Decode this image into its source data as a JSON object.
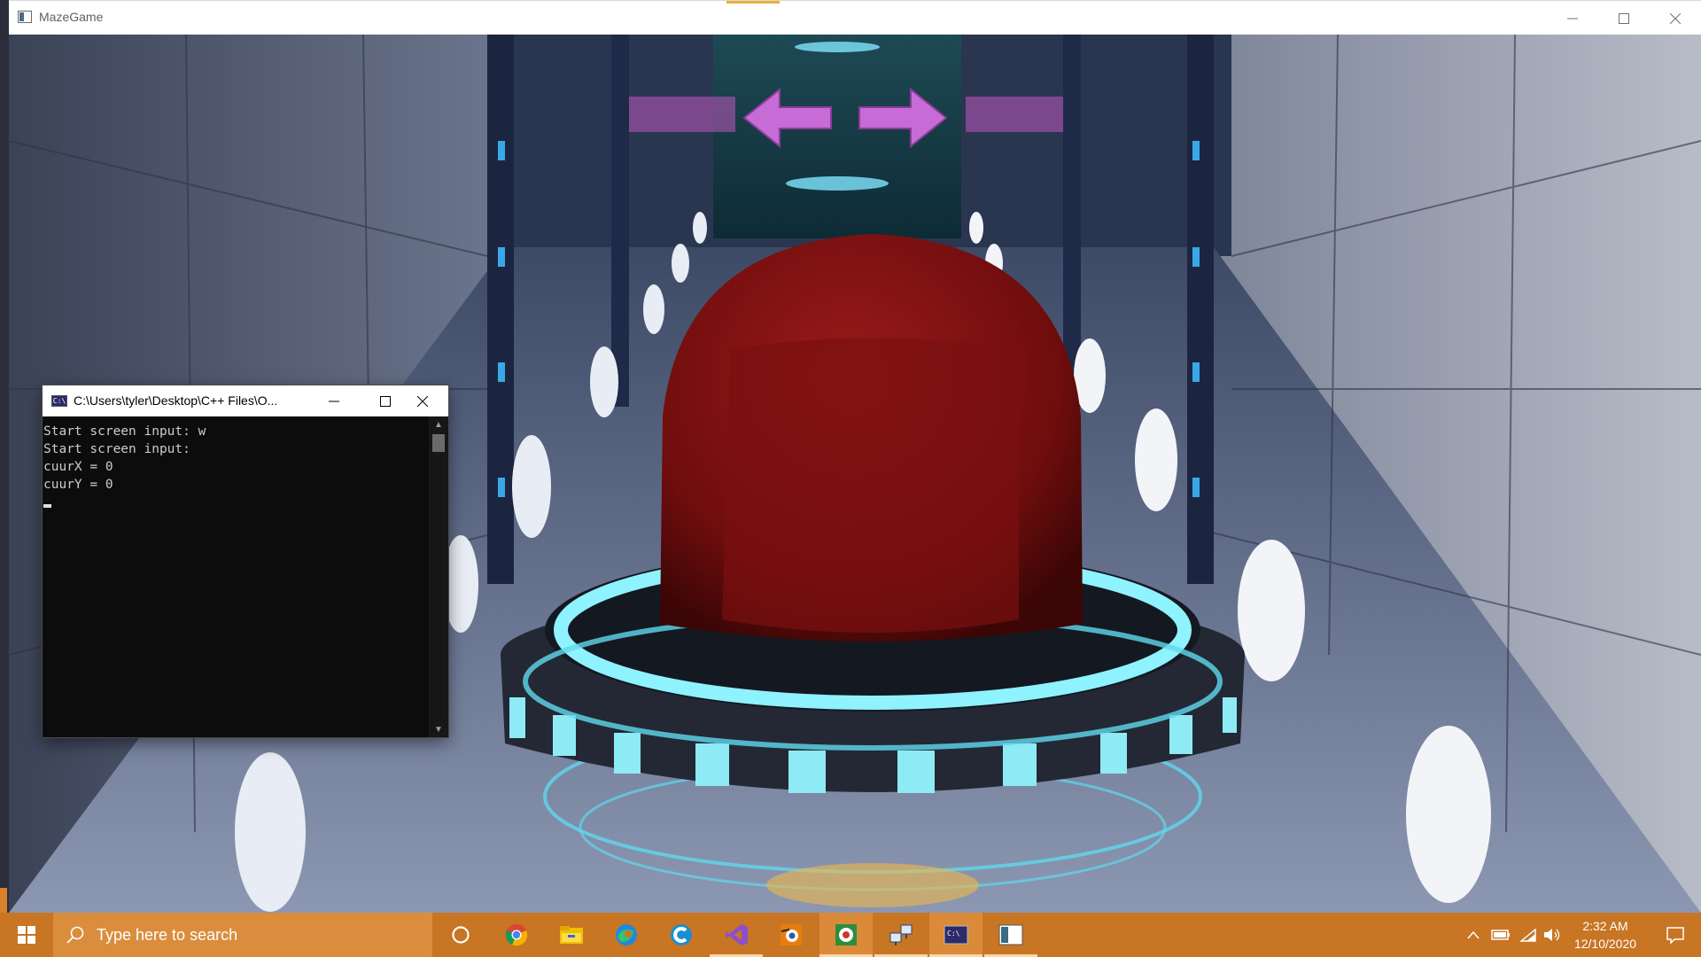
{
  "game_window": {
    "title": "MazeGame",
    "controls": [
      "minimize",
      "maximize",
      "close"
    ]
  },
  "console": {
    "title": "C:\\Users\\tyler\\Desktop\\C++ Files\\O...",
    "icon_label": "C:\\",
    "lines": [
      "Start screen input: w",
      "Start screen input:",
      "cuurX = 0",
      "cuurY = 0"
    ]
  },
  "taskbar": {
    "search_placeholder": "Type here to search",
    "pinned": [
      {
        "name": "cortana-icon"
      },
      {
        "name": "chrome-icon"
      },
      {
        "name": "file-explorer-icon"
      },
      {
        "name": "edge-icon"
      },
      {
        "name": "ccleaner-icon"
      },
      {
        "name": "visual-studio-icon"
      },
      {
        "name": "blender-icon"
      },
      {
        "name": "obs-icon"
      },
      {
        "name": "network-app-icon"
      },
      {
        "name": "console-app-icon"
      },
      {
        "name": "mazegame-app-icon"
      }
    ],
    "clock": {
      "time": "2:32 AM",
      "date": "12/10/2020"
    },
    "colors": {
      "taskbar": "#c87524",
      "search": "#db8d3e"
    }
  }
}
